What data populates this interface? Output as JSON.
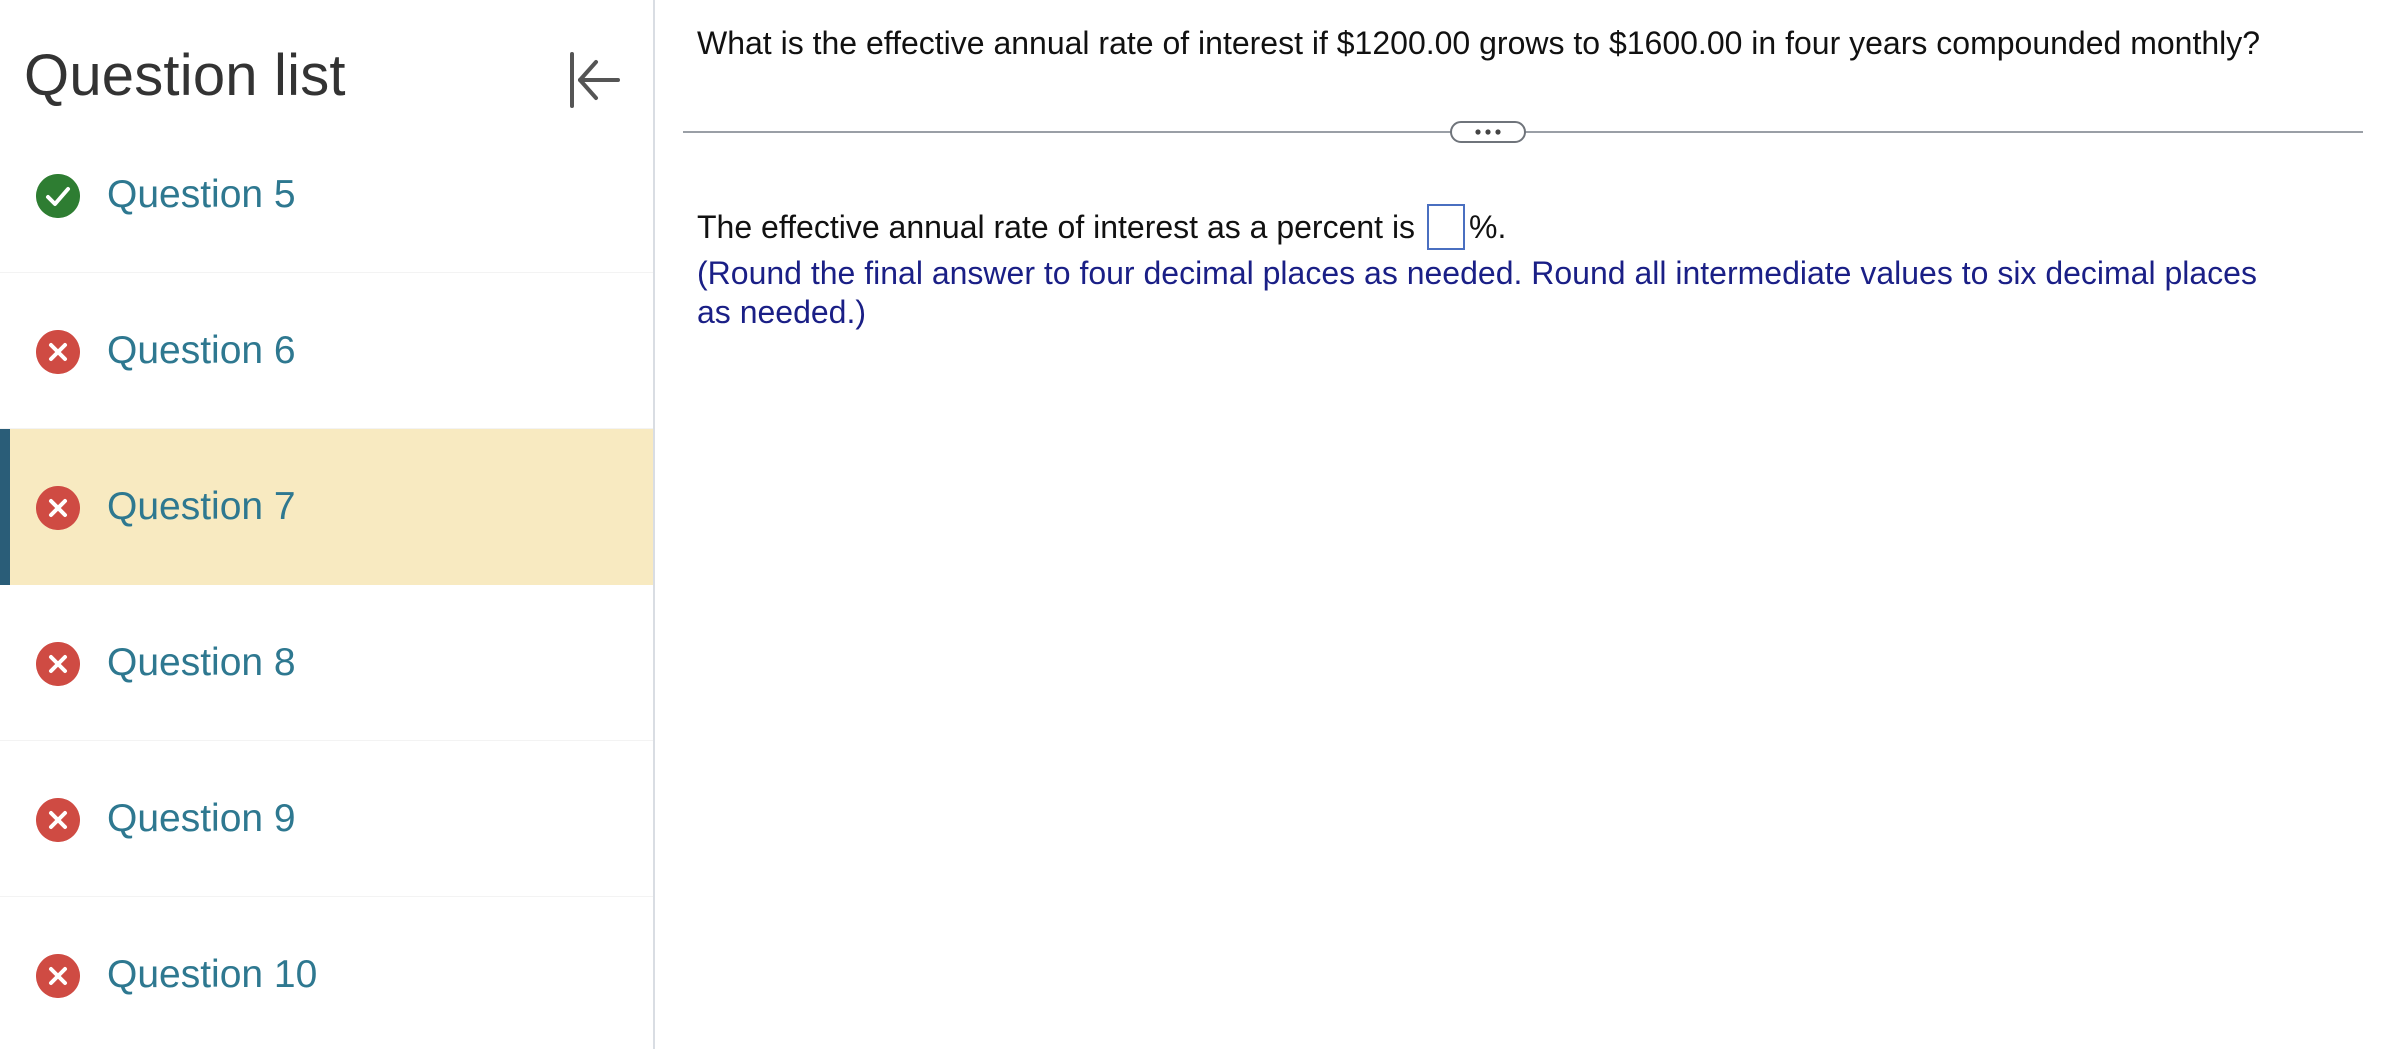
{
  "sidebar": {
    "title": "Question list",
    "collapse_icon": "collapse-left-icon",
    "items": [
      {
        "label": "Question 5",
        "status": "correct",
        "status_icon": "check-circle-icon"
      },
      {
        "label": "Question 6",
        "status": "incorrect",
        "status_icon": "x-circle-icon"
      },
      {
        "label": "Question 7",
        "status": "incorrect",
        "status_icon": "x-circle-icon",
        "active": true
      },
      {
        "label": "Question 8",
        "status": "incorrect",
        "status_icon": "x-circle-icon"
      },
      {
        "label": "Question 9",
        "status": "incorrect",
        "status_icon": "x-circle-icon"
      },
      {
        "label": "Question 10",
        "status": "incorrect",
        "status_icon": "x-circle-icon"
      }
    ]
  },
  "main": {
    "question_text": "What is the effective annual rate of interest if $1200.00 grows to $1600.00 in four years compounded monthly?",
    "expand_icon": "ellipsis-icon",
    "answer_prefix": "The effective annual rate of interest as a percent is",
    "answer_value": "",
    "answer_suffix": "%.",
    "instructions": "(Round the final answer to four decimal places as needed. Round all intermediate values to six decimal places as needed.)"
  },
  "colors": {
    "correct": "#2e7d32",
    "incorrect": "#cf4b43",
    "active_row": "#f8eac1",
    "active_bar": "#2a5d78",
    "link_text": "#2e7890",
    "instruction_text": "#1a1f86"
  }
}
